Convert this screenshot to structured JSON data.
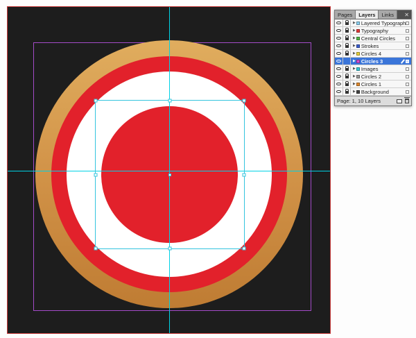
{
  "colors": {
    "page_bg": "#1d1d1d",
    "bleed_guide": "#c83a3a",
    "margin_guide": "#a44bc9",
    "ruler_guide": "#00d2e6",
    "gold_light": "#e0ad5e",
    "gold_dark": "#bf7c33",
    "red": "#e2212b",
    "white": "#ffffff",
    "selection": "#33c4de",
    "selected_row": "#3a75d9"
  },
  "canvas": {
    "objects": [
      "gold-outer-circle",
      "red-ring-circle",
      "white-circle",
      "center-red-circle"
    ],
    "guides": [
      "vertical-center-guide",
      "horizontal-center-guide"
    ],
    "selection": "center-red-circle"
  },
  "panel": {
    "tabs": [
      {
        "label": "Pages",
        "active": false
      },
      {
        "label": "Layers",
        "active": true
      },
      {
        "label": "Links",
        "active": false
      }
    ],
    "close_glyph": "✕",
    "expand_glyph": "▶",
    "icons": {
      "eye": "css-ellipse",
      "lock": "css-padlock",
      "pen": "css-pen-stroke",
      "new_layer": "css-square",
      "trash": "css-trashcan"
    },
    "layers": [
      {
        "name": "Layered Typography",
        "visible": true,
        "locked": true,
        "selected": false,
        "color": "#8cd0f0"
      },
      {
        "name": "Typography",
        "visible": true,
        "locked": true,
        "selected": false,
        "color": "#e23a3a"
      },
      {
        "name": "Central Circles",
        "visible": true,
        "locked": true,
        "selected": false,
        "color": "#53b848"
      },
      {
        "name": "Strokes",
        "visible": true,
        "locked": true,
        "selected": false,
        "color": "#3c5fd0"
      },
      {
        "name": "Circles 4",
        "visible": true,
        "locked": true,
        "selected": false,
        "color": "#e8d23a"
      },
      {
        "name": "Circles 3",
        "visible": true,
        "locked": false,
        "selected": true,
        "color": "#d44fd4"
      },
      {
        "name": "Images",
        "visible": true,
        "locked": true,
        "selected": false,
        "color": "#38c8d8"
      },
      {
        "name": "Circles 2",
        "visible": true,
        "locked": true,
        "selected": false,
        "color": "#9a9a9a"
      },
      {
        "name": "Circles 1",
        "visible": true,
        "locked": true,
        "selected": false,
        "color": "#e08a2e"
      },
      {
        "name": "Background",
        "visible": true,
        "locked": true,
        "selected": false,
        "color": "#444444"
      }
    ],
    "status": {
      "text": "Page: 1, 10 Layers"
    }
  }
}
